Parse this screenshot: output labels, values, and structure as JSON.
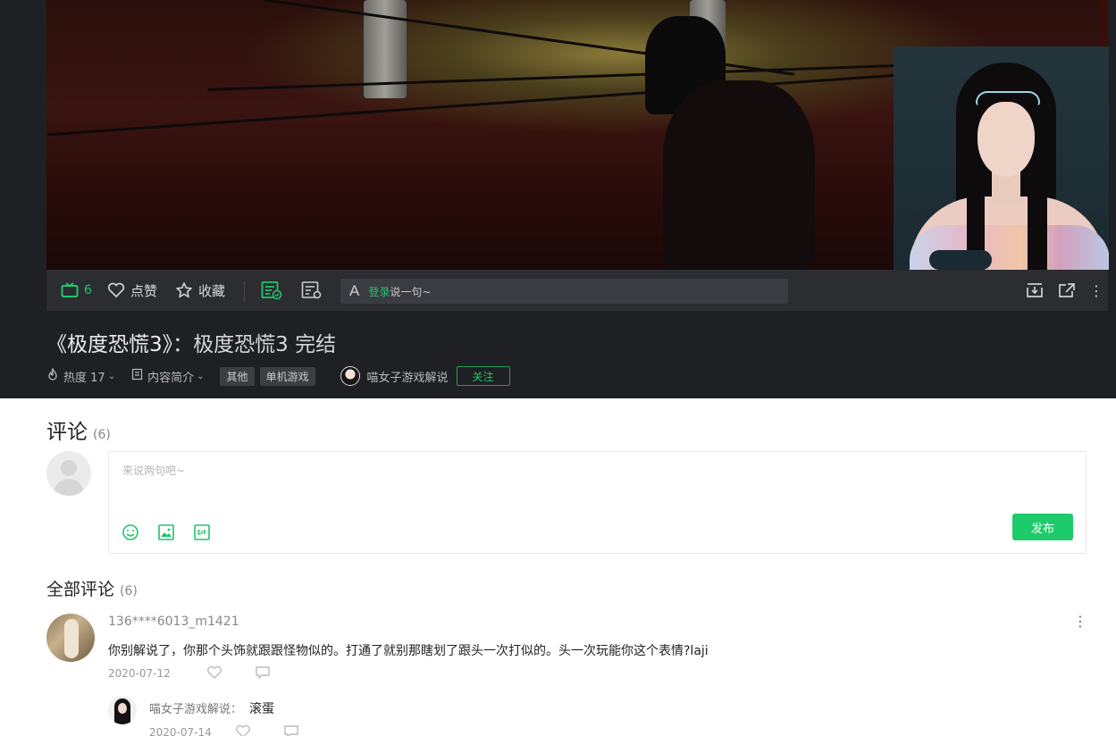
{
  "player": {
    "danmaku_count": "6",
    "like_label": "点赞",
    "favorite_label": "收藏",
    "danmaku_input_prefix": "A",
    "danmaku_login_link": "登录",
    "danmaku_placeholder": "说一句~"
  },
  "video": {
    "title_main": "《极度恐慌3》",
    "title_suffix": "：极度恐慌3 完结",
    "heat_label": "热度 17",
    "intro_label": "内容简介",
    "tags": [
      "其他",
      "单机游戏"
    ],
    "uploader_name": "喵女子游戏解说",
    "follow_label": "关注"
  },
  "comments_section": {
    "heading": "评论",
    "count": "(6)",
    "input_placeholder": "来说两句吧~",
    "publish_label": "发布",
    "all_heading": "全部评论",
    "all_count": "(6)"
  },
  "comments": [
    {
      "user": "136****6013_m1421",
      "text": "你别解说了，你那个头饰就跟跟怪物似的。打通了就别那瞎划了跟头一次打似的。头一次玩能你这个表情?laji",
      "date": "2020-07-12",
      "more": "⋮",
      "reply": {
        "user": "喵女子游戏解说：",
        "text": "滚蛋",
        "date": "2020-07-14"
      }
    }
  ],
  "colors": {
    "accent_green": "#1ecb6a",
    "dark_bg": "#1f2023",
    "toolbar_bg": "#2b2d31"
  }
}
